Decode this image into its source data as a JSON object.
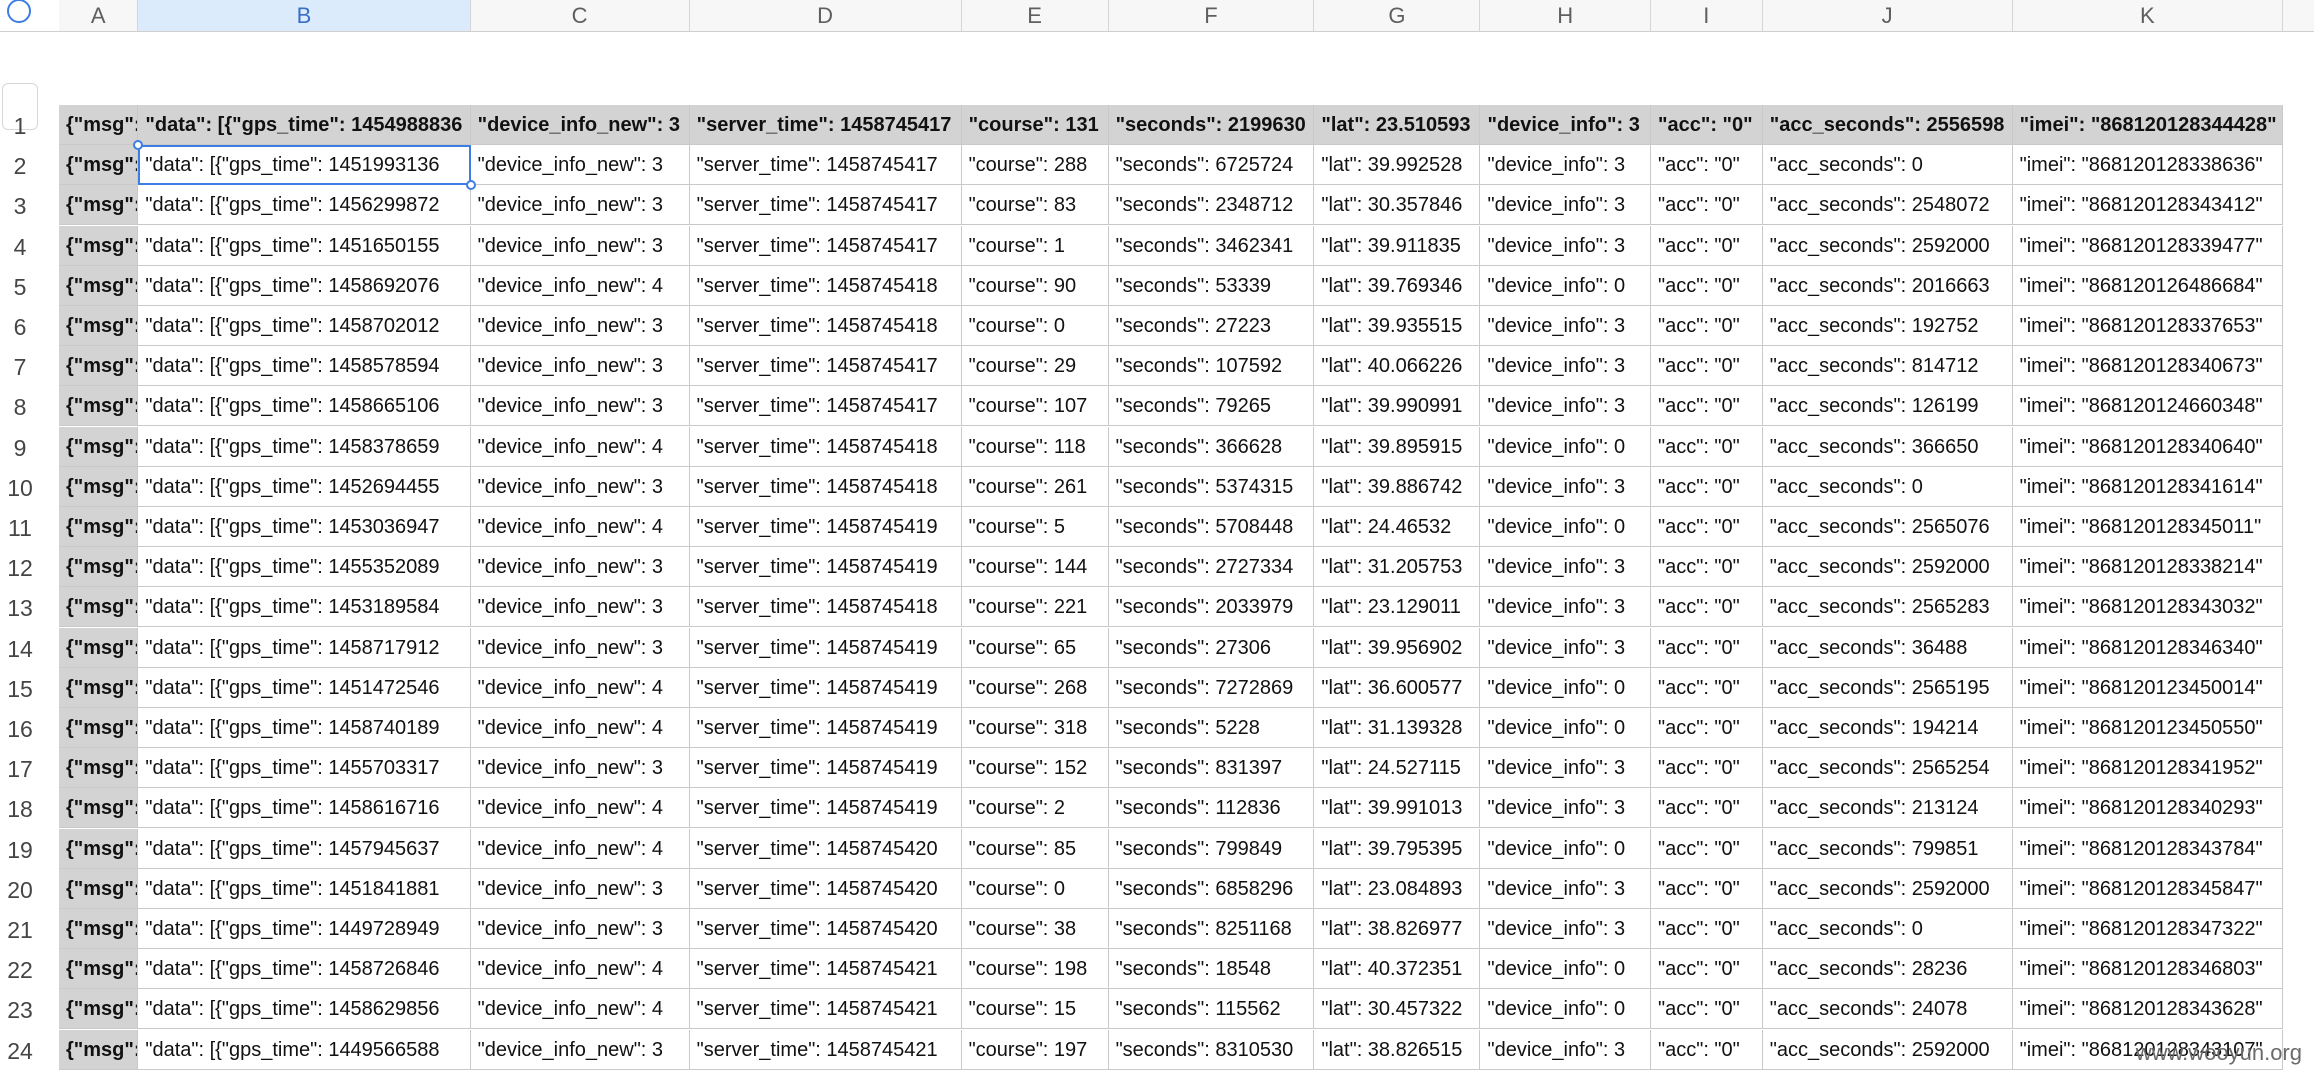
{
  "columns": [
    "A",
    "B",
    "C",
    "D",
    "E",
    "F",
    "G",
    "H",
    "I",
    "J",
    "K"
  ],
  "selected_column": "B",
  "row_numbers": [
    "1",
    "2",
    "3",
    "4",
    "5",
    "6",
    "7",
    "8",
    "9",
    "10",
    "11",
    "12",
    "13",
    "14",
    "15",
    "16",
    "17",
    "18",
    "19",
    "20",
    "21",
    "22",
    "23",
    "24"
  ],
  "rows": [
    [
      "{\"msg\": \"",
      "\"data\": [{\"gps_time\": 1454988836",
      "\"device_info_new\": 3",
      "\"server_time\": 1458745417",
      "\"course\": 131",
      "\"seconds\": 2199630",
      "\"lat\": 23.510593",
      "\"device_info\": 3",
      "\"acc\": \"0\"",
      "\"acc_seconds\": 2556598",
      "\"imei\": \"868120128344428\""
    ],
    [
      "{\"msg\": \"",
      "\"data\": [{\"gps_time\": 1451993136",
      "\"device_info_new\": 3",
      "\"server_time\": 1458745417",
      "\"course\": 288",
      "\"seconds\": 6725724",
      "\"lat\": 39.992528",
      "\"device_info\": 3",
      "\"acc\": \"0\"",
      "\"acc_seconds\": 0",
      "\"imei\": \"868120128338636\""
    ],
    [
      "{\"msg\": \"",
      "\"data\": [{\"gps_time\": 1456299872",
      "\"device_info_new\": 3",
      "\"server_time\": 1458745417",
      "\"course\": 83",
      "\"seconds\": 2348712",
      "\"lat\": 30.357846",
      "\"device_info\": 3",
      "\"acc\": \"0\"",
      "\"acc_seconds\": 2548072",
      "\"imei\": \"868120128343412\""
    ],
    [
      "{\"msg\": \"",
      "\"data\": [{\"gps_time\": 1451650155",
      "\"device_info_new\": 3",
      "\"server_time\": 1458745417",
      "\"course\": 1",
      "\"seconds\": 3462341",
      "\"lat\": 39.911835",
      "\"device_info\": 3",
      "\"acc\": \"0\"",
      "\"acc_seconds\": 2592000",
      "\"imei\": \"868120128339477\""
    ],
    [
      "{\"msg\": \"",
      "\"data\": [{\"gps_time\": 1458692076",
      "\"device_info_new\": 4",
      "\"server_time\": 1458745418",
      "\"course\": 90",
      "\"seconds\": 53339",
      "\"lat\": 39.769346",
      "\"device_info\": 0",
      "\"acc\": \"0\"",
      "\"acc_seconds\": 2016663",
      "\"imei\": \"868120126486684\""
    ],
    [
      "{\"msg\": \"",
      "\"data\": [{\"gps_time\": 1458702012",
      "\"device_info_new\": 3",
      "\"server_time\": 1458745418",
      "\"course\": 0",
      "\"seconds\": 27223",
      "\"lat\": 39.935515",
      "\"device_info\": 3",
      "\"acc\": \"0\"",
      "\"acc_seconds\": 192752",
      "\"imei\": \"868120128337653\""
    ],
    [
      "{\"msg\": \"",
      "\"data\": [{\"gps_time\": 1458578594",
      "\"device_info_new\": 3",
      "\"server_time\": 1458745417",
      "\"course\": 29",
      "\"seconds\": 107592",
      "\"lat\": 40.066226",
      "\"device_info\": 3",
      "\"acc\": \"0\"",
      "\"acc_seconds\": 814712",
      "\"imei\": \"868120128340673\""
    ],
    [
      "{\"msg\": \"",
      "\"data\": [{\"gps_time\": 1458665106",
      "\"device_info_new\": 3",
      "\"server_time\": 1458745417",
      "\"course\": 107",
      "\"seconds\": 79265",
      "\"lat\": 39.990991",
      "\"device_info\": 3",
      "\"acc\": \"0\"",
      "\"acc_seconds\": 126199",
      "\"imei\": \"868120124660348\""
    ],
    [
      "{\"msg\": \"",
      "\"data\": [{\"gps_time\": 1458378659",
      "\"device_info_new\": 4",
      "\"server_time\": 1458745418",
      "\"course\": 118",
      "\"seconds\": 366628",
      "\"lat\": 39.895915",
      "\"device_info\": 0",
      "\"acc\": \"0\"",
      "\"acc_seconds\": 366650",
      "\"imei\": \"868120128340640\""
    ],
    [
      "{\"msg\": \"",
      "\"data\": [{\"gps_time\": 1452694455",
      "\"device_info_new\": 3",
      "\"server_time\": 1458745418",
      "\"course\": 261",
      "\"seconds\": 5374315",
      "\"lat\": 39.886742",
      "\"device_info\": 3",
      "\"acc\": \"0\"",
      "\"acc_seconds\": 0",
      "\"imei\": \"868120128341614\""
    ],
    [
      "{\"msg\": \"",
      "\"data\": [{\"gps_time\": 1453036947",
      "\"device_info_new\": 4",
      "\"server_time\": 1458745419",
      "\"course\": 5",
      "\"seconds\": 5708448",
      "\"lat\": 24.46532",
      "\"device_info\": 0",
      "\"acc\": \"0\"",
      "\"acc_seconds\": 2565076",
      "\"imei\": \"868120128345011\""
    ],
    [
      "{\"msg\": \"",
      "\"data\": [{\"gps_time\": 1455352089",
      "\"device_info_new\": 3",
      "\"server_time\": 1458745419",
      "\"course\": 144",
      "\"seconds\": 2727334",
      "\"lat\": 31.205753",
      "\"device_info\": 3",
      "\"acc\": \"0\"",
      "\"acc_seconds\": 2592000",
      "\"imei\": \"868120128338214\""
    ],
    [
      "{\"msg\": \"",
      "\"data\": [{\"gps_time\": 1453189584",
      "\"device_info_new\": 3",
      "\"server_time\": 1458745418",
      "\"course\": 221",
      "\"seconds\": 2033979",
      "\"lat\": 23.129011",
      "\"device_info\": 3",
      "\"acc\": \"0\"",
      "\"acc_seconds\": 2565283",
      "\"imei\": \"868120128343032\""
    ],
    [
      "{\"msg\": \"",
      "\"data\": [{\"gps_time\": 1458717912",
      "\"device_info_new\": 3",
      "\"server_time\": 1458745419",
      "\"course\": 65",
      "\"seconds\": 27306",
      "\"lat\": 39.956902",
      "\"device_info\": 3",
      "\"acc\": \"0\"",
      "\"acc_seconds\": 36488",
      "\"imei\": \"868120128346340\""
    ],
    [
      "{\"msg\": \"",
      "\"data\": [{\"gps_time\": 1451472546",
      "\"device_info_new\": 4",
      "\"server_time\": 1458745419",
      "\"course\": 268",
      "\"seconds\": 7272869",
      "\"lat\": 36.600577",
      "\"device_info\": 0",
      "\"acc\": \"0\"",
      "\"acc_seconds\": 2565195",
      "\"imei\": \"868120123450014\""
    ],
    [
      "{\"msg\": \"",
      "\"data\": [{\"gps_time\": 1458740189",
      "\"device_info_new\": 4",
      "\"server_time\": 1458745419",
      "\"course\": 318",
      "\"seconds\": 5228",
      "\"lat\": 31.139328",
      "\"device_info\": 0",
      "\"acc\": \"0\"",
      "\"acc_seconds\": 194214",
      "\"imei\": \"868120123450550\""
    ],
    [
      "{\"msg\": \"",
      "\"data\": [{\"gps_time\": 1455703317",
      "\"device_info_new\": 3",
      "\"server_time\": 1458745419",
      "\"course\": 152",
      "\"seconds\": 831397",
      "\"lat\": 24.527115",
      "\"device_info\": 3",
      "\"acc\": \"0\"",
      "\"acc_seconds\": 2565254",
      "\"imei\": \"868120128341952\""
    ],
    [
      "{\"msg\": \"",
      "\"data\": [{\"gps_time\": 1458616716",
      "\"device_info_new\": 4",
      "\"server_time\": 1458745419",
      "\"course\": 2",
      "\"seconds\": 112836",
      "\"lat\": 39.991013",
      "\"device_info\": 3",
      "\"acc\": \"0\"",
      "\"acc_seconds\": 213124",
      "\"imei\": \"868120128340293\""
    ],
    [
      "{\"msg\": \"",
      "\"data\": [{\"gps_time\": 1457945637",
      "\"device_info_new\": 4",
      "\"server_time\": 1458745420",
      "\"course\": 85",
      "\"seconds\": 799849",
      "\"lat\": 39.795395",
      "\"device_info\": 0",
      "\"acc\": \"0\"",
      "\"acc_seconds\": 799851",
      "\"imei\": \"868120128343784\""
    ],
    [
      "{\"msg\": \"",
      "\"data\": [{\"gps_time\": 1451841881",
      "\"device_info_new\": 3",
      "\"server_time\": 1458745420",
      "\"course\": 0",
      "\"seconds\": 6858296",
      "\"lat\": 23.084893",
      "\"device_info\": 3",
      "\"acc\": \"0\"",
      "\"acc_seconds\": 2592000",
      "\"imei\": \"868120128345847\""
    ],
    [
      "{\"msg\": \"",
      "\"data\": [{\"gps_time\": 1449728949",
      "\"device_info_new\": 3",
      "\"server_time\": 1458745420",
      "\"course\": 38",
      "\"seconds\": 8251168",
      "\"lat\": 38.826977",
      "\"device_info\": 3",
      "\"acc\": \"0\"",
      "\"acc_seconds\": 0",
      "\"imei\": \"868120128347322\""
    ],
    [
      "{\"msg\": \"",
      "\"data\": [{\"gps_time\": 1458726846",
      "\"device_info_new\": 4",
      "\"server_time\": 1458745421",
      "\"course\": 198",
      "\"seconds\": 18548",
      "\"lat\": 40.372351",
      "\"device_info\": 0",
      "\"acc\": \"0\"",
      "\"acc_seconds\": 28236",
      "\"imei\": \"868120128346803\""
    ],
    [
      "{\"msg\": \"",
      "\"data\": [{\"gps_time\": 1458629856",
      "\"device_info_new\": 4",
      "\"server_time\": 1458745421",
      "\"course\": 15",
      "\"seconds\": 115562",
      "\"lat\": 30.457322",
      "\"device_info\": 0",
      "\"acc\": \"0\"",
      "\"acc_seconds\": 24078",
      "\"imei\": \"868120128343628\""
    ],
    [
      "{\"msg\": \"",
      "\"data\": [{\"gps_time\": 1449566588",
      "\"device_info_new\": 3",
      "\"server_time\": 1458745421",
      "\"course\": 197",
      "\"seconds\": 8310530",
      "\"lat\": 38.826515",
      "\"device_info\": 3",
      "\"acc\": \"0\"",
      "\"acc_seconds\": 2592000",
      "\"imei\": \"868120128343107\""
    ]
  ],
  "watermark": "www.wooyun.org"
}
